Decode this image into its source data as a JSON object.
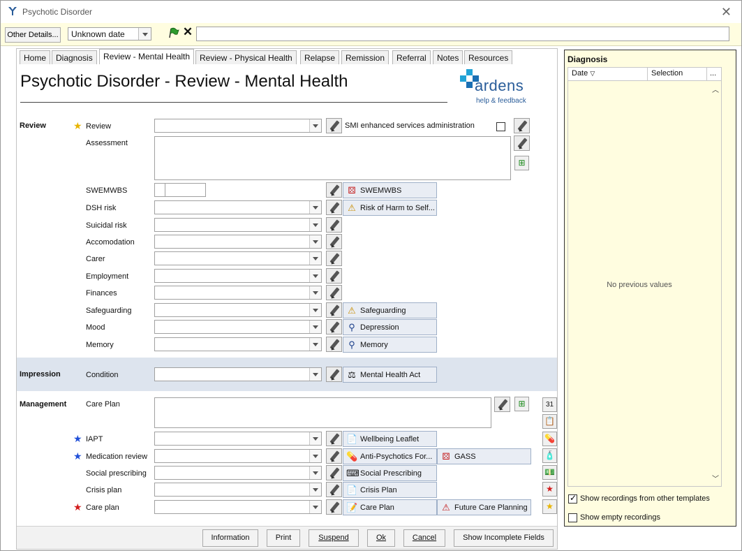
{
  "window": {
    "title": "Psychotic Disorder",
    "close_icon": "close-icon"
  },
  "toolbar": {
    "other_details": "Other Details...",
    "date_value": "Unknown date",
    "text_value": ""
  },
  "tabs": [
    {
      "label": "Home"
    },
    {
      "label": "Diagnosis"
    },
    {
      "label": "Review - Mental Health",
      "active": true
    },
    {
      "label": "Review - Physical Health"
    },
    {
      "label": "Relapse"
    },
    {
      "label": "Remission"
    },
    {
      "label": "Referral"
    },
    {
      "label": "Notes"
    },
    {
      "label": "Resources"
    }
  ],
  "page": {
    "title": "Psychotic Disorder - Review - Mental Health",
    "logo": {
      "word": "ardens",
      "sub": "help & feedback"
    }
  },
  "review": {
    "section": "Review",
    "smi_label": "SMI enhanced services administration",
    "fields": {
      "review": "Review",
      "assessment": "Assessment",
      "swemwbs": "SWEMWBS",
      "dsh": "DSH risk",
      "suicidal": "Suicidal risk",
      "accom": "Accomodation",
      "carer": "Carer",
      "employment": "Employment",
      "finances": "Finances",
      "safeguarding": "Safeguarding",
      "mood": "Mood",
      "memory": "Memory"
    },
    "links": {
      "swemwbs": "SWEMWBS",
      "risk": "Risk of Harm to Self...",
      "safeguarding": "Safeguarding",
      "depression": "Depression",
      "memory": "Memory"
    }
  },
  "impression": {
    "section": "Impression",
    "condition": "Condition",
    "link": "Mental Health Act"
  },
  "management": {
    "section": "Management",
    "fields": {
      "care_plan_text": "Care Plan",
      "iapt": "IAPT",
      "medication": "Medication review",
      "social": "Social prescribing",
      "crisis": "Crisis plan",
      "care_plan": "Care plan"
    },
    "links": {
      "wellbeing": "Wellbeing Leaflet",
      "antipsych": "Anti-Psychotics For...",
      "gass": "GASS",
      "social": "Social Prescribing",
      "crisis": "Crisis Plan",
      "careplan": "Care Plan",
      "future": "Future Care Planning"
    }
  },
  "footer": {
    "information": "Information",
    "print": "Print",
    "suspend": "Suspend",
    "ok": "Ok",
    "cancel": "Cancel",
    "show_incomplete": "Show Incomplete Fields"
  },
  "diagnosis_panel": {
    "title": "Diagnosis",
    "col_date": "Date",
    "col_selection": "Selection",
    "col_more": "...",
    "empty_text": "No previous values",
    "show_other": "Show recordings from other templates",
    "show_other_checked": true,
    "show_empty": "Show empty recordings",
    "show_empty_checked": false
  },
  "colors": {
    "accent": "#2a5d9a",
    "panel_bg": "#fffde0",
    "band": "#dde4ee",
    "star_yellow": "#e8b400",
    "star_blue": "#1f4fd8",
    "star_red": "#d21c1c"
  }
}
